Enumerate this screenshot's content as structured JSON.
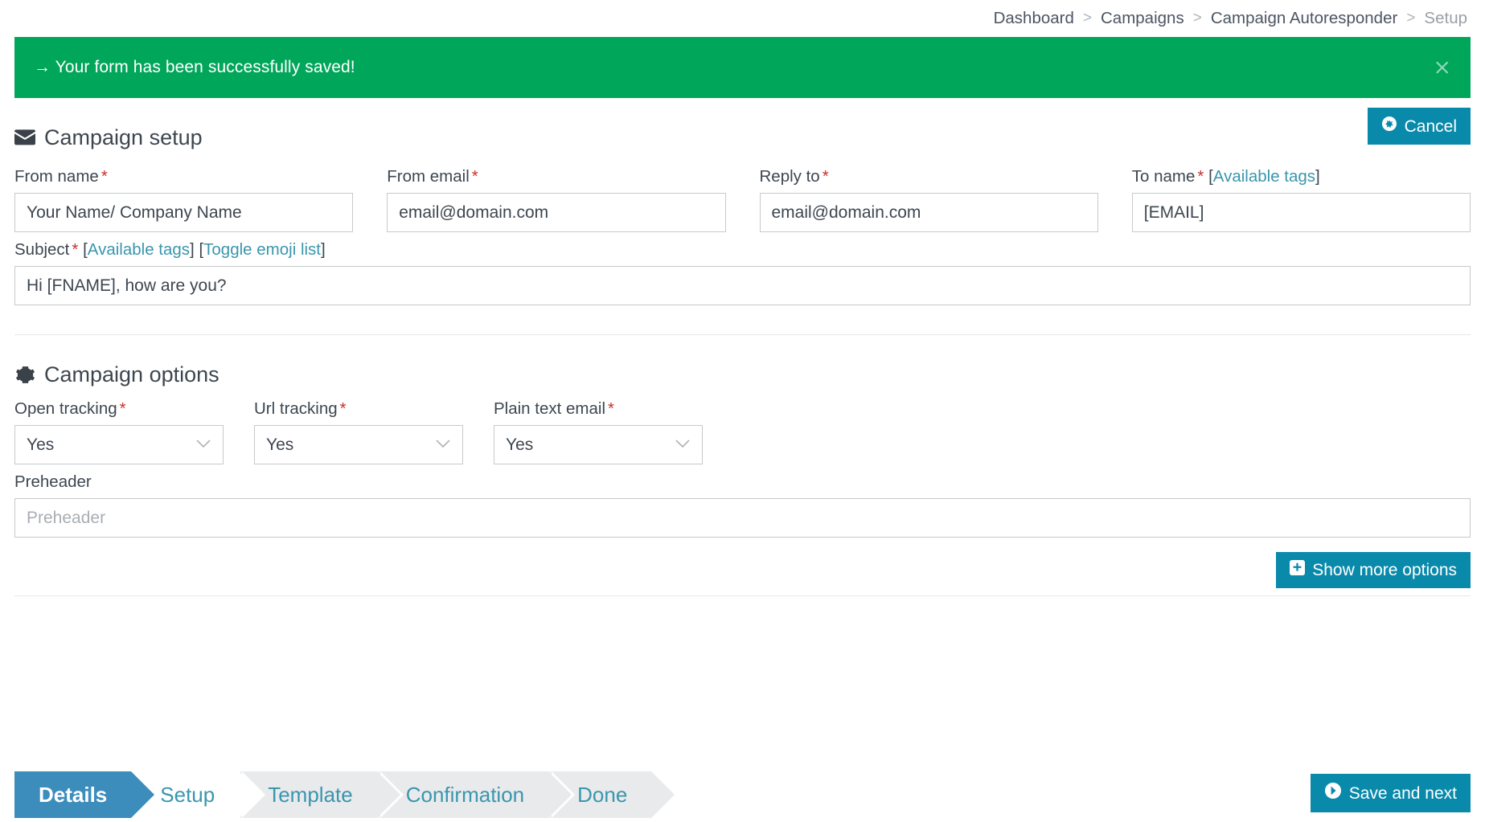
{
  "breadcrumb": {
    "items": [
      {
        "label": "Dashboard",
        "current": false
      },
      {
        "label": "Campaigns",
        "current": false
      },
      {
        "label": "Campaign Autoresponder",
        "current": false
      },
      {
        "label": "Setup",
        "current": true
      }
    ],
    "separator": ">"
  },
  "alert": {
    "message": "→ Your form has been successfully saved!",
    "close_label": "×",
    "color": "#00a65a"
  },
  "setup_section": {
    "title": "Campaign setup",
    "icon": "envelope-icon",
    "cancel_label": "Cancel",
    "cancel_icon": "ban-circle-icon"
  },
  "fields": {
    "from_name": {
      "label": "From name",
      "required": "*",
      "value": "Your Name/ Company Name",
      "placeholder": "From name"
    },
    "from_email": {
      "label": "From email",
      "required": "*",
      "value": "email@domain.com",
      "placeholder": "From email"
    },
    "reply_to": {
      "label": "Reply to",
      "required": "*",
      "value": "email@domain.com",
      "placeholder": "Reply to"
    },
    "to_name": {
      "label": "To name",
      "required": "*",
      "tags_link": "Available tags",
      "value": "[EMAIL]",
      "placeholder": "To name"
    },
    "subject": {
      "label": "Subject",
      "required": "*",
      "tags_link": "Available tags",
      "emoji_link": "Toggle emoji list",
      "value": "Hi [FNAME], how are you?",
      "placeholder": "Subject"
    },
    "preheader": {
      "label": "Preheader",
      "value": "",
      "placeholder": "Preheader"
    }
  },
  "options_section": {
    "title": "Campaign options",
    "icon": "gear-icon",
    "open_tracking": {
      "label": "Open tracking",
      "required": "*",
      "value": "Yes"
    },
    "url_tracking": {
      "label": "Url tracking",
      "required": "*",
      "value": "Yes"
    },
    "plain_text_email": {
      "label": "Plain text email",
      "required": "*",
      "value": "Yes"
    },
    "show_more_label": "Show more options",
    "show_more_icon": "plus-square-icon"
  },
  "wizard": {
    "steps": [
      {
        "label": "Details",
        "state": "active"
      },
      {
        "label": "Setup",
        "state": "white"
      },
      {
        "label": "Template",
        "state": "gray"
      },
      {
        "label": "Confirmation",
        "state": "gray"
      },
      {
        "label": "Done",
        "state": "gray"
      }
    ],
    "save_label": "Save and next",
    "save_icon": "arrow-circle-right-icon"
  },
  "colors": {
    "accent_teal": "#0a8aab",
    "link_teal": "#3a96ad",
    "success_green": "#00a65a",
    "active_blue": "#3c8dbc",
    "required_red": "#c9302c"
  }
}
